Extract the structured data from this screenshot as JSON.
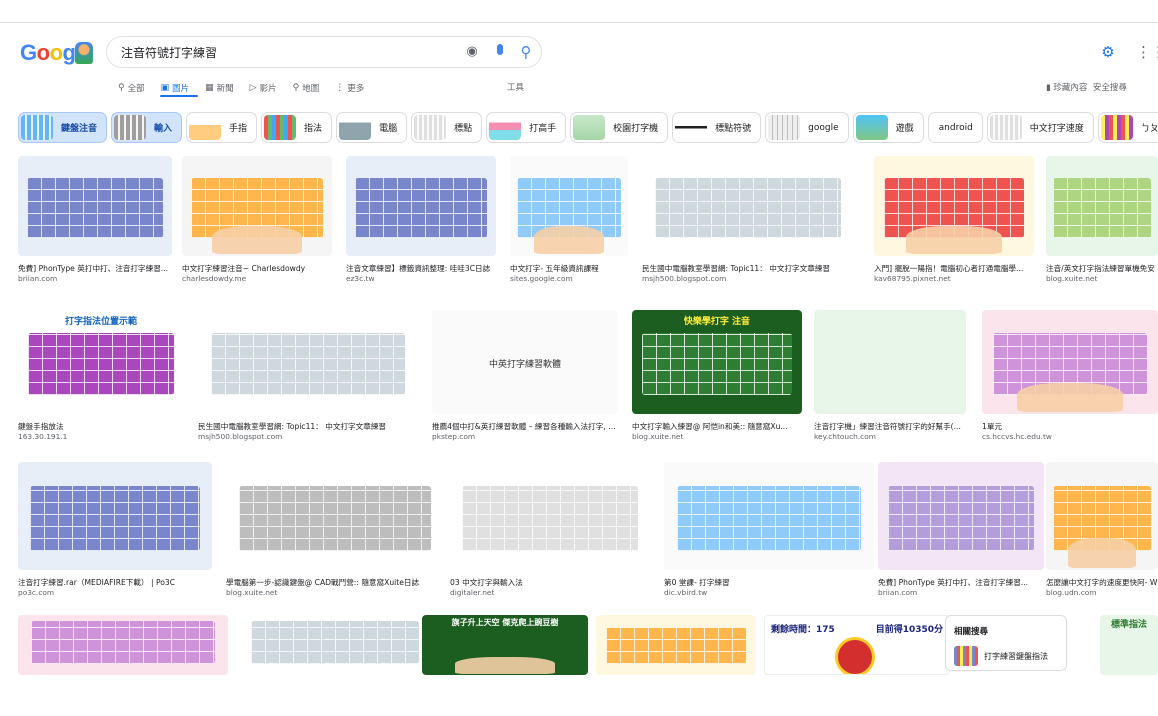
{
  "search": {
    "query": "注音符號打字練習"
  },
  "nav": {
    "tabs": [
      {
        "label": "全部",
        "icon": "search-icon"
      },
      {
        "label": "圖片",
        "icon": "image-icon"
      },
      {
        "label": "新聞",
        "icon": "news-icon"
      },
      {
        "label": "影片",
        "icon": "video-icon"
      },
      {
        "label": "地圖",
        "icon": "map-pin-icon"
      },
      {
        "label": "更多",
        "icon": "more-icon"
      }
    ],
    "tools": "工具",
    "saved": "珍藏內容",
    "safesearch": "安全搜尋"
  },
  "chips": [
    {
      "label": "鍵盤注音"
    },
    {
      "label": "輸入"
    },
    {
      "label": "手指"
    },
    {
      "label": "指法"
    },
    {
      "label": "電腦"
    },
    {
      "label": "標點"
    },
    {
      "label": "打高手"
    },
    {
      "label": "校園打字機"
    },
    {
      "label": "標點符號"
    },
    {
      "label": "google"
    },
    {
      "label": "遊戲"
    },
    {
      "label": "android"
    },
    {
      "label": "中文打字速度"
    },
    {
      "label": "ㄅㄆㄇ"
    }
  ],
  "results": {
    "row1": [
      {
        "title": "免費] PhonType 英打中打、注音打字練習...",
        "source": "briian.com"
      },
      {
        "title": "中文打字練習注音~ Charlesdowdy",
        "source": "charlesdowdy.me"
      },
      {
        "title": "注音文章練習】標籤資訊整理: 哇哇3C日誌",
        "source": "ez3c.tw"
      },
      {
        "title": "中文打字- 五年級資訊課程",
        "source": "sites.google.com"
      },
      {
        "title": "民生國中電腦教室學習網: Topic11： 中文打字文章練習",
        "source": "msjh500.blogspot.com"
      },
      {
        "title": "入門] 擺脫一陽指！電腦初心者打通電腦學...",
        "source": "kav68795.pixnet.net"
      },
      {
        "title": "注音/英文打字指法練習單機免安",
        "source": "blog.xuite.net"
      }
    ],
    "row2": [
      {
        "title": "鍵盤手指放法",
        "source": "163.30.191.1",
        "caption": "打字指法位置示範"
      },
      {
        "title": "民生國中電腦教室學習網: Topic11： 中文打字文章練習",
        "source": "msjh500.blogspot.com"
      },
      {
        "title": "推薦4個中打&英打練習軟體 – 練習各種輸入法打字, 並...",
        "source": "pkstep.com",
        "caption": "中英打字練習軟體"
      },
      {
        "title": "中文打字輸入練習@ 阿恺in和美:: 隨意窩Xu...",
        "source": "blog.xuite.net",
        "caption": "快樂學打字 注音"
      },
      {
        "title": "注音打字機」練習注音符號打字的好幫手(...",
        "source": "key.chtouch.com"
      },
      {
        "title": "1單元",
        "source": "cs.hccvs.hc.edu.tw"
      }
    ],
    "row3": [
      {
        "title": "注音打字練習.rar（MEDIAFIRE下載） | Po3C",
        "source": "po3c.com"
      },
      {
        "title": "學電腦第一步-認識鍵盤@ CAD戰鬥營:: 隨意窩Xuite日誌",
        "source": "blog.xuite.net"
      },
      {
        "title": "03 中文打字與輸入法",
        "source": "digitaler.net"
      },
      {
        "title": "第0 堂課- 打字練習",
        "source": "dic.vbird.tw"
      },
      {
        "title": "免費] PhonType 英打中打、注音打字練習...",
        "source": "briian.com"
      },
      {
        "title": "怎麼讓中文打字的速度更快阿- W",
        "source": "blog.udn.com"
      }
    ],
    "row4": [
      {
        "caption": ""
      },
      {
        "caption": ""
      },
      {
        "caption": "旗子升上天空 傑克爬上豌豆樹"
      },
      {
        "caption": ""
      },
      {
        "time_label": "剩餘時間：175",
        "score_label": "目前得10350分"
      },
      {
        "caption": "標準指法"
      }
    ]
  },
  "related": {
    "heading": "相關搜尋",
    "item": "打字練習鍵盤指法"
  }
}
